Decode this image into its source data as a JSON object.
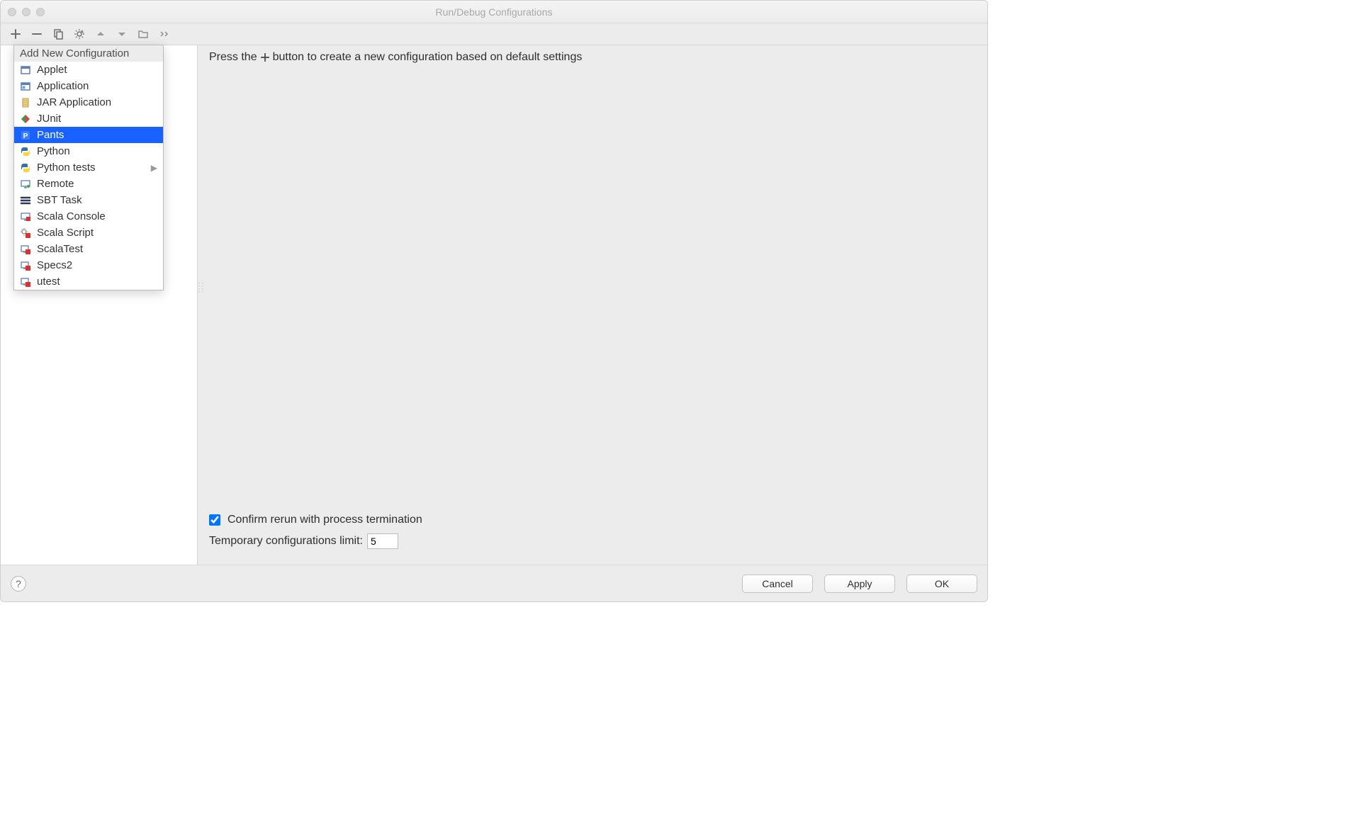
{
  "window": {
    "title": "Run/Debug Configurations"
  },
  "hint": {
    "before": "Press the",
    "after": "button to create a new configuration based on default settings"
  },
  "options": {
    "confirm_rerun_label": "Confirm rerun with process termination",
    "confirm_rerun_checked": true,
    "temp_limit_label": "Temporary configurations limit:",
    "temp_limit_value": "5"
  },
  "buttons": {
    "cancel": "Cancel",
    "apply": "Apply",
    "ok": "OK"
  },
  "help_symbol": "?",
  "popup": {
    "title": "Add New Configuration",
    "selected_index": 4,
    "items": [
      {
        "label": "Applet",
        "icon": "applet",
        "submenu": false
      },
      {
        "label": "Application",
        "icon": "app",
        "submenu": false
      },
      {
        "label": "JAR Application",
        "icon": "jar",
        "submenu": false
      },
      {
        "label": "JUnit",
        "icon": "junit",
        "submenu": false
      },
      {
        "label": "Pants",
        "icon": "pants",
        "submenu": false
      },
      {
        "label": "Python",
        "icon": "python",
        "submenu": false
      },
      {
        "label": "Python tests",
        "icon": "python",
        "submenu": true
      },
      {
        "label": "Remote",
        "icon": "remote",
        "submenu": false
      },
      {
        "label": "SBT Task",
        "icon": "sbt",
        "submenu": false
      },
      {
        "label": "Scala Console",
        "icon": "scala",
        "submenu": false
      },
      {
        "label": "Scala Script",
        "icon": "scalascript",
        "submenu": false
      },
      {
        "label": "ScalaTest",
        "icon": "scalatest",
        "submenu": false
      },
      {
        "label": "Specs2",
        "icon": "scalatest",
        "submenu": false
      },
      {
        "label": "utest",
        "icon": "scalatest",
        "submenu": false
      }
    ]
  }
}
